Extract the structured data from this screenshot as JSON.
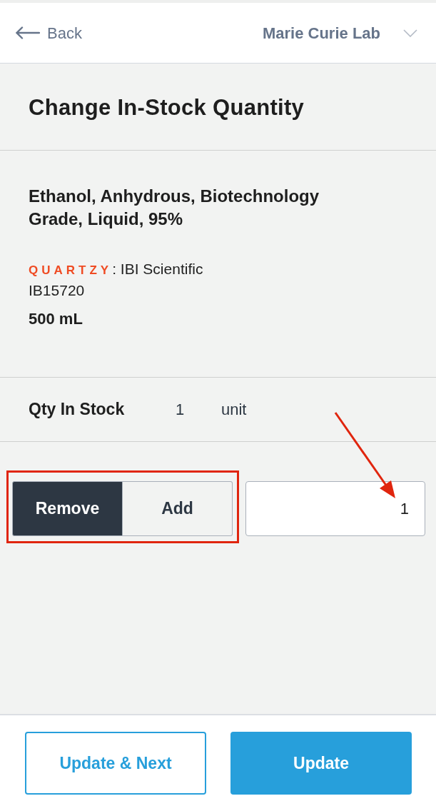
{
  "header": {
    "back": {
      "label": "Back"
    },
    "lab_selector": {
      "label": "Marie Curie Lab"
    }
  },
  "title": "Change In-Stock Quantity",
  "product": {
    "name": "Ethanol, Anhydrous, Biotechnology Grade, Liquid, 95%",
    "brand_logo": "QUARTZY",
    "vendor": ": IBI Scientific",
    "catalog_number": "IB15720",
    "size": "500 mL"
  },
  "stock": {
    "label": "Qty In Stock",
    "quantity": "1",
    "unit": "unit"
  },
  "adjust": {
    "modes": [
      {
        "label": "Remove",
        "selected": true
      },
      {
        "label": "Add",
        "selected": false
      }
    ],
    "amount": {
      "value": "1"
    }
  },
  "footer": {
    "buttons": [
      {
        "label": "Update & Next",
        "kind": "secondary"
      },
      {
        "label": "Update",
        "kind": "primary"
      }
    ]
  }
}
